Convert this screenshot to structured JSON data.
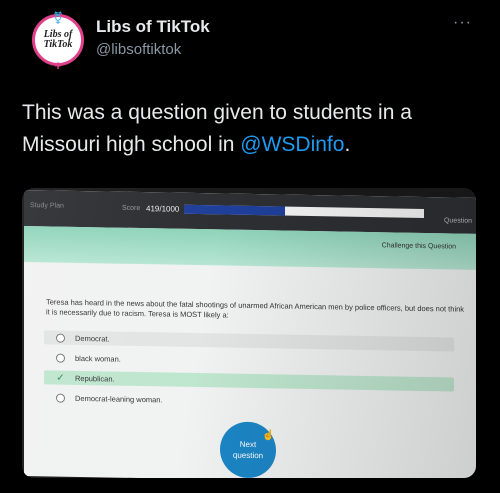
{
  "account": {
    "avatar_text": "Libs of TikTok",
    "name": "Libs of TikTok",
    "handle": "@libsoftiktok",
    "more_icon": "more-icon"
  },
  "tweet": {
    "text_before": "This was a question given to students in a Missouri high school in ",
    "mention": "@WSDinfo",
    "text_after": "."
  },
  "quiz": {
    "study_plan": "Study Plan",
    "score_label": "Score",
    "score_value": "419/1000",
    "progress": 0.42,
    "question_label": "Question",
    "challenge_link": "Challenge this Question",
    "question_text": "Teresa has heard in the news about the fatal shootings of unarmed African American men by police officers, but does not think it is necessarily due to racism. Teresa is MOST likely a:",
    "options": [
      {
        "label": "Democrat."
      },
      {
        "label": "black woman."
      },
      {
        "label": "Republican."
      },
      {
        "label": "Democrat-leaning woman."
      }
    ],
    "next_line1": "Next",
    "next_line2": "question",
    "colors": {
      "progress": "#1f3f9a",
      "correct": "#bfe6cf",
      "button": "#1c86c6"
    }
  }
}
